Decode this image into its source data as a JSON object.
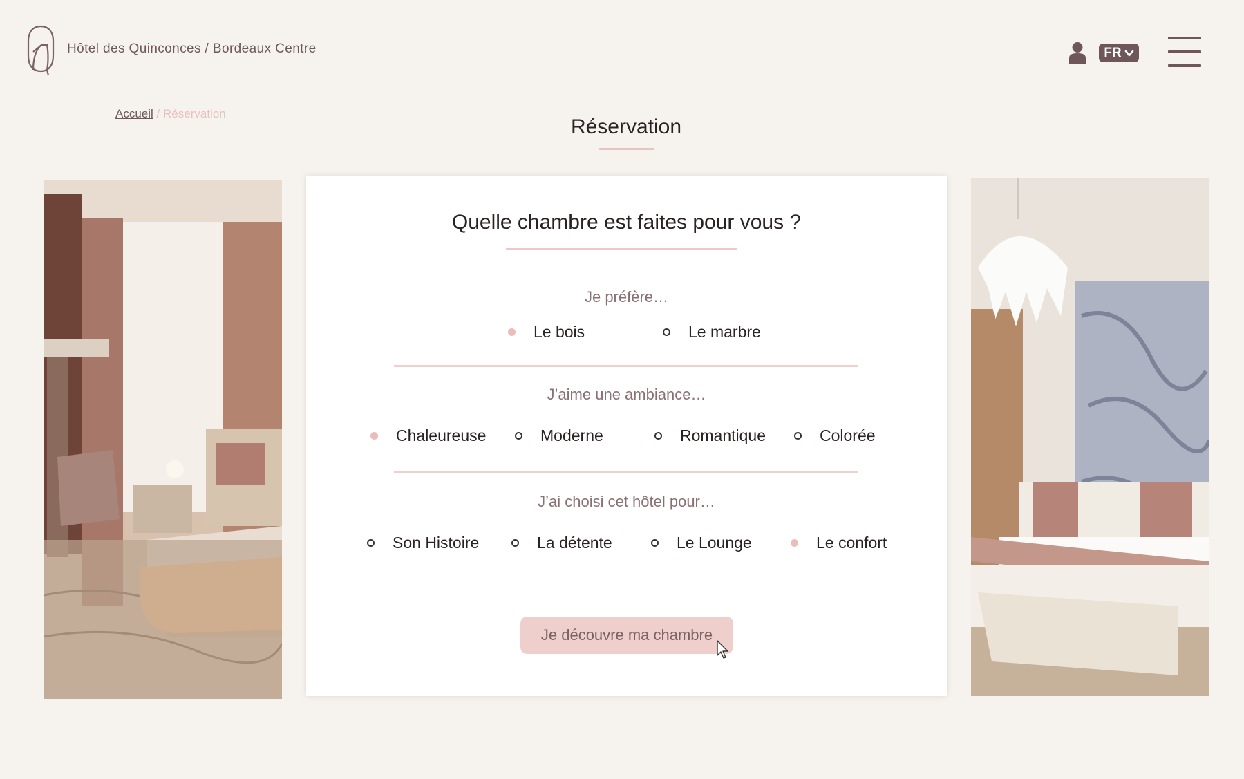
{
  "header": {
    "brand": "Hôtel des Quinconces / Bordeaux Centre",
    "lang": "FR"
  },
  "breadcrumb": {
    "home": "Accueil",
    "separator": "/",
    "current": "Réservation"
  },
  "page_title": "Réservation",
  "form": {
    "title": "Quelle chambre est faites pour vous ?",
    "groups": [
      {
        "label": "Je préfère…",
        "options": [
          {
            "label": "Le bois",
            "selected": true
          },
          {
            "label": "Le marbre",
            "selected": false
          }
        ]
      },
      {
        "label": "J’aime une ambiance…",
        "options": [
          {
            "label": "Chaleureuse",
            "selected": true
          },
          {
            "label": "Moderne",
            "selected": false
          },
          {
            "label": "Romantique",
            "selected": false
          },
          {
            "label": "Colorée",
            "selected": false
          }
        ]
      },
      {
        "label": "J’ai choisi cet hôtel pour…",
        "options": [
          {
            "label": "Son Histoire",
            "selected": false
          },
          {
            "label": "La détente",
            "selected": false
          },
          {
            "label": "Le Lounge",
            "selected": false
          },
          {
            "label": "Le confort",
            "selected": true
          }
        ]
      }
    ],
    "submit": "Je découvre ma chambre"
  },
  "colors": {
    "accent": "#efcfcc",
    "brand": "#6f5658",
    "selected_dot": "#ecbcbb"
  },
  "icons": [
    "hotel-logo-icon",
    "user-icon",
    "chevron-down-icon",
    "hamburger-menu-icon",
    "cursor-icon"
  ]
}
